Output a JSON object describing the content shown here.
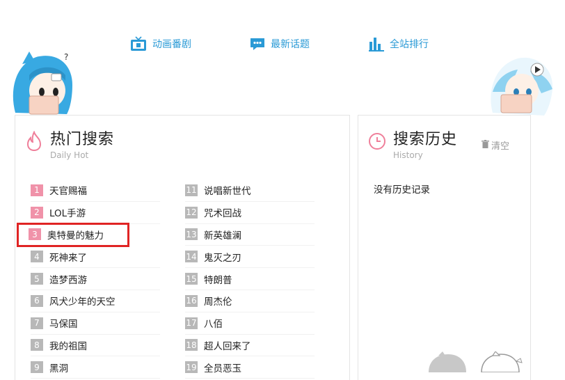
{
  "nav": {
    "items": [
      {
        "label": "动画番剧",
        "icon": "tv-icon"
      },
      {
        "label": "最新话题",
        "icon": "chat-bubble-icon"
      },
      {
        "label": "全站排行",
        "icon": "bar-chart-icon"
      }
    ]
  },
  "hot": {
    "title": "热门搜索",
    "subtitle": "Daily Hot",
    "items": [
      {
        "rank": "1",
        "keyword": "天官赐福"
      },
      {
        "rank": "2",
        "keyword": "LOL手游"
      },
      {
        "rank": "3",
        "keyword": "奥特曼的魅力"
      },
      {
        "rank": "4",
        "keyword": "死神来了"
      },
      {
        "rank": "5",
        "keyword": "造梦西游"
      },
      {
        "rank": "6",
        "keyword": "风犬少年的天空"
      },
      {
        "rank": "7",
        "keyword": "马保国"
      },
      {
        "rank": "8",
        "keyword": "我的祖国"
      },
      {
        "rank": "9",
        "keyword": "黑洞"
      },
      {
        "rank": "11",
        "keyword": "说唱新世代"
      },
      {
        "rank": "12",
        "keyword": "咒术回战"
      },
      {
        "rank": "13",
        "keyword": "新英雄澜"
      },
      {
        "rank": "14",
        "keyword": "鬼灭之刃"
      },
      {
        "rank": "15",
        "keyword": "特朗普"
      },
      {
        "rank": "16",
        "keyword": "周杰伦"
      },
      {
        "rank": "17",
        "keyword": "八佰"
      },
      {
        "rank": "18",
        "keyword": "超人回来了"
      },
      {
        "rank": "19",
        "keyword": "全员恶玉"
      }
    ]
  },
  "history": {
    "title": "搜索历史",
    "subtitle": "History",
    "clear_label": "清空",
    "empty_message": "没有历史记录"
  },
  "colors": {
    "accent": "#2a9ad6",
    "rank_top": "#f092a9",
    "rank_default": "#b8b8b8",
    "highlight": "#e02424"
  }
}
